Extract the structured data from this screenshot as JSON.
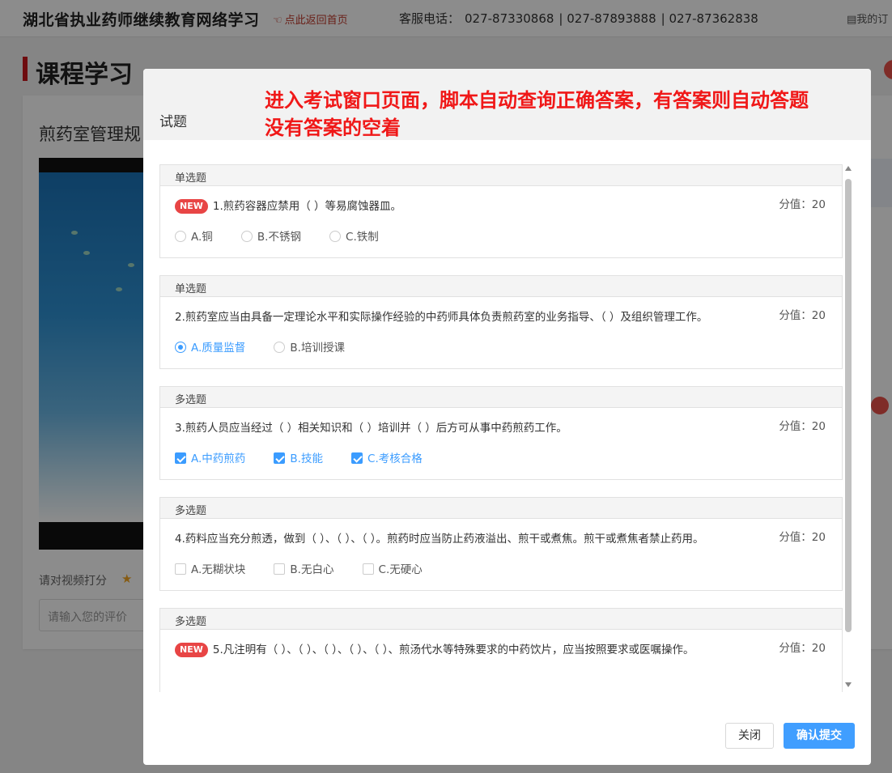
{
  "header": {
    "site_title": "湖北省执业药师继续教育网络学习",
    "home_link": "点此返回首页",
    "hotline_label": "客服电话：",
    "phones": [
      "027-87330868",
      "| 027-87893888",
      "| 027-87362838"
    ],
    "my_link": "我的订"
  },
  "page": {
    "title": "课程学习",
    "course_name": "煎药室管理规",
    "rate_label": "请对视频打分",
    "comment_placeholder": "请输入您的评价"
  },
  "modal": {
    "title": "试题",
    "annotation_line1": "进入考试窗口页面，脚本自动查询正确答案，有答案则自动答题",
    "annotation_line2": "没有答案的空着",
    "close_label": "关闭",
    "submit_label": "确认提交",
    "questions": [
      {
        "type": "单选题",
        "new": true,
        "badge": "NEW",
        "text": "1.煎药容器应禁用（ ）等易腐蚀器皿。",
        "score": "分值：20",
        "kind": "radio",
        "options": [
          {
            "label": "A.铜",
            "selected": false
          },
          {
            "label": "B.不锈钢",
            "selected": false
          },
          {
            "label": "C.铁制",
            "selected": false
          }
        ]
      },
      {
        "type": "单选题",
        "new": false,
        "text": "2.煎药室应当由具备一定理论水平和实际操作经验的中药师具体负责煎药室的业务指导、（ ）及组织管理工作。",
        "score": "分值：20",
        "kind": "radio",
        "options": [
          {
            "label": "A.质量监督",
            "selected": true
          },
          {
            "label": "B.培训授课",
            "selected": false
          }
        ]
      },
      {
        "type": "多选题",
        "new": false,
        "text": "3.煎药人员应当经过（ ）相关知识和（ ）培训并（ ）后方可从事中药煎药工作。",
        "score": "分值：20",
        "kind": "checkbox",
        "options": [
          {
            "label": "A.中药煎药",
            "selected": true
          },
          {
            "label": "B.技能",
            "selected": true
          },
          {
            "label": "C.考核合格",
            "selected": true
          }
        ]
      },
      {
        "type": "多选题",
        "new": false,
        "text": "4.药料应当充分煎透，做到（ ）、（ ）、（ ）。煎药时应当防止药液溢出、煎干或煮焦。煎干或煮焦者禁止药用。",
        "score": "分值：20",
        "kind": "checkbox",
        "options": [
          {
            "label": "A.无糊状块",
            "selected": false
          },
          {
            "label": "B.无白心",
            "selected": false
          },
          {
            "label": "C.无硬心",
            "selected": false
          }
        ]
      },
      {
        "type": "多选题",
        "new": true,
        "badge": "NEW",
        "text": "5.凡注明有（ ）、（ ）、（ ）、（ ）、（ ）、煎汤代水等特殊要求的中药饮片，应当按照要求或医嘱操作。",
        "score": "分值：20",
        "kind": "checkbox",
        "options": []
      }
    ]
  },
  "colors": {
    "accent_blue": "#409eff",
    "annotation_red": "#f01818",
    "badge_red": "#e84545",
    "brand_red": "#c8161d"
  }
}
